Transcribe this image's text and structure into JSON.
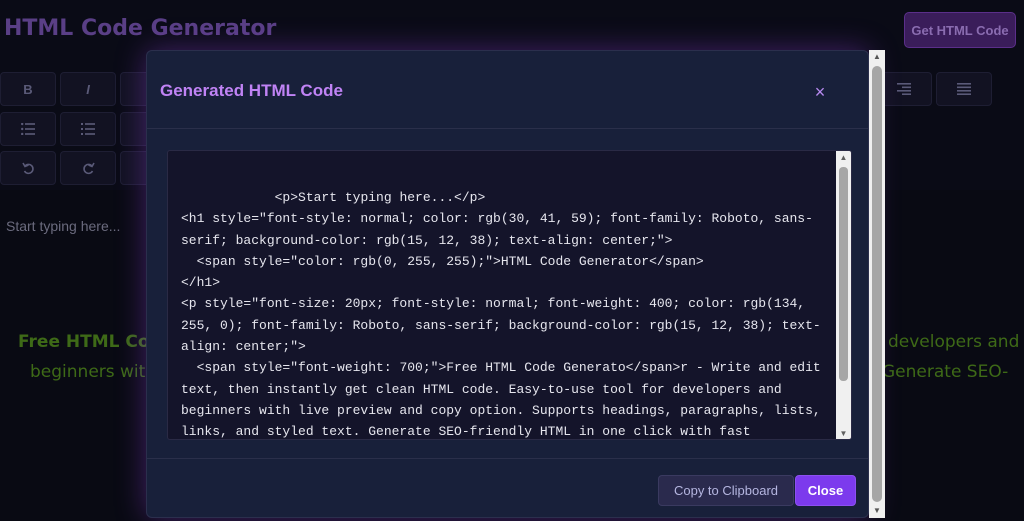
{
  "app": {
    "title": "HTML Code Generator",
    "get_code_button": "Get HTML Code"
  },
  "toolbar": {
    "bold_label": "B",
    "italic_label": "I",
    "icons": [
      "bold-icon",
      "italic-icon",
      "align-right-icon",
      "justify-icon",
      "bullet-list-icon",
      "numbered-list-icon",
      "undo-icon",
      "redo-icon"
    ]
  },
  "editor": {
    "placeholder": "Start typing here...",
    "preview_line1_left": "Free HTML Cod",
    "preview_line1_right": "developers and",
    "preview_line2_left": "beginners with",
    "preview_line2_right": "Generate SEO-"
  },
  "modal": {
    "title": "Generated HTML Code",
    "close_glyph": "×",
    "code": "            <p>Start typing here...</p>\n<h1 style=\"font-style: normal; color: rgb(30, 41, 59); font-family: Roboto, sans-serif; background-color: rgb(15, 12, 38); text-align: center;\">\n  <span style=\"color: rgb(0, 255, 255);\">HTML Code Generator</span>\n</h1>\n<p style=\"font-size: 20px; font-style: normal; font-weight: 400; color: rgb(134, 255, 0); font-family: Roboto, sans-serif; background-color: rgb(15, 12, 38); text-align: center;\">\n  <span style=\"font-weight: 700;\">Free HTML Code Generato</span>r - Write and edit text, then instantly get clean HTML code. Easy-to-use tool for developers and beginners with live preview and copy option. Supports headings, paragraphs, lists, links, and styled text. Generate SEO-friendly HTML in one click with fast",
    "copy_button": "Copy to Clipboard",
    "close_button": "Close"
  },
  "colors": {
    "accent": "#7c3aed",
    "title": "#c083f5",
    "modal_bg": "#18203a"
  }
}
